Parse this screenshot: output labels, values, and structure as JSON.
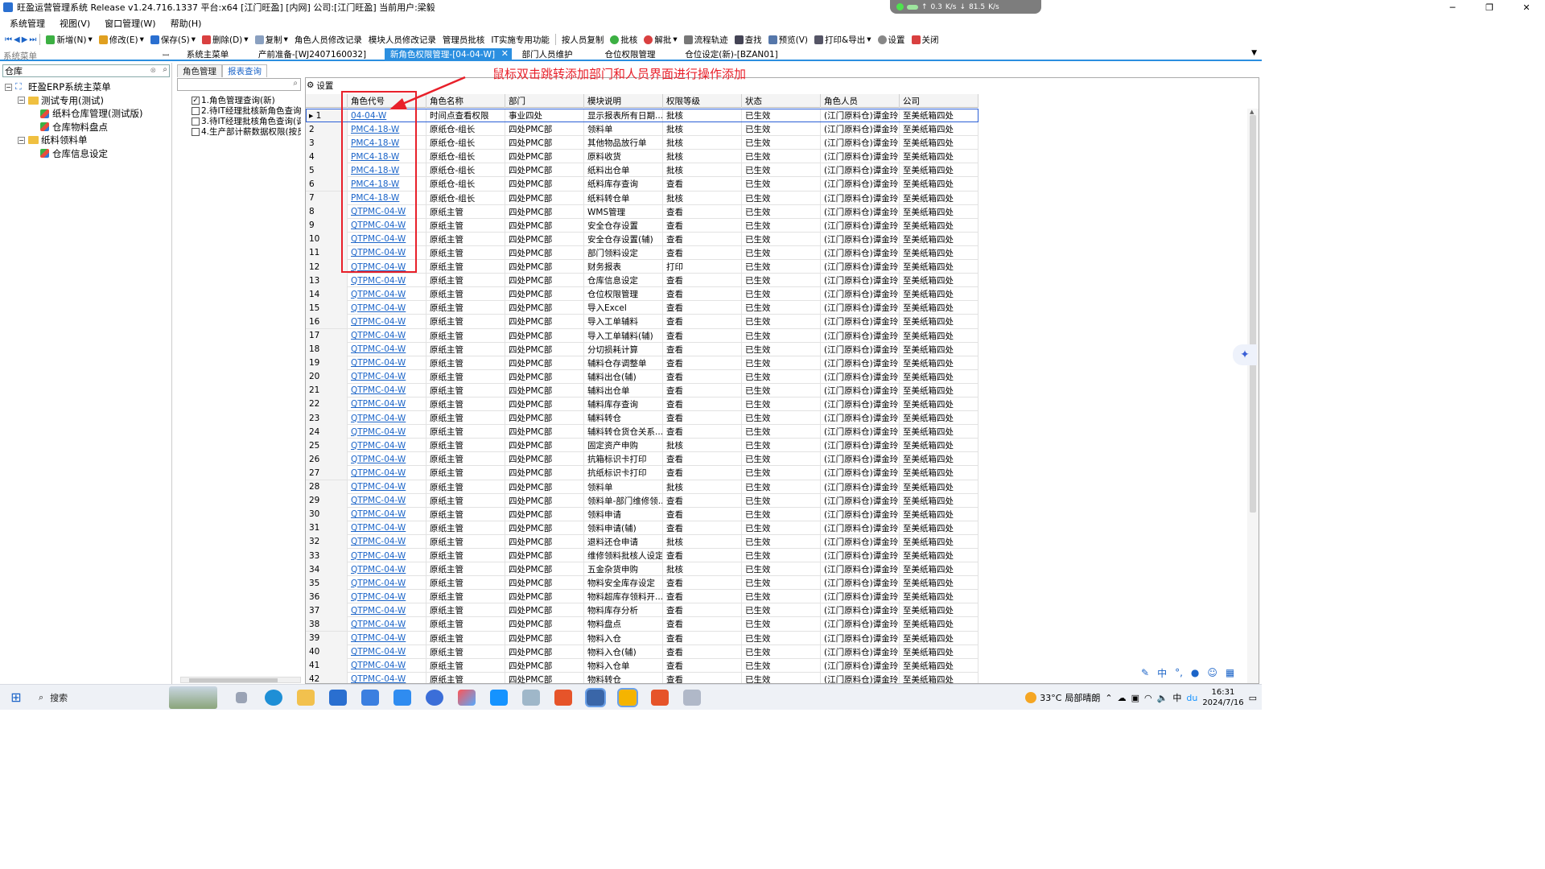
{
  "window": {
    "title": "旺盈运营管理系统 Release v1.24.716.1337 平台:x64  [江门旺盈] [内网] 公司:[江门旺盈] 当前用户:梁毅",
    "net_up": "0.3",
    "net_up_unit": "K/s",
    "net_down": "81.5",
    "net_down_unit": "K/s",
    "btn_min": "─",
    "btn_max": "❐",
    "btn_close": "✕"
  },
  "menu": [
    "系统管理",
    "视图(V)",
    "窗口管理(W)",
    "帮助(H)"
  ],
  "toolbar": {
    "new": "新增(N)",
    "edit": "修改(E)",
    "save": "保存(S)",
    "delete": "删除(D)",
    "copy": "复制",
    "role_person_log": "角色人员修改记录",
    "module_person_log": "模块人员修改记录",
    "admin_approve": "管理员批核",
    "it_func": "IT实施专用功能",
    "person_copy": "按人员复制",
    "approve": "批核",
    "unapprove": "解批",
    "flow": "流程轨迹",
    "find": "查找",
    "preview": "预览(V)",
    "print_export": "打印&导出",
    "settings": "设置",
    "close": "关闭"
  },
  "sidebar": {
    "label": "系统菜单",
    "pin": "ꟷ",
    "search_value": "仓库",
    "tree": [
      {
        "label": "旺盈ERP系统主菜单",
        "level": 0,
        "kind": "root",
        "toggle": "⊟"
      },
      {
        "label": "测试专用(测试)",
        "level": 1,
        "kind": "folder",
        "toggle": "⊟"
      },
      {
        "label": "纸料仓库管理(测试版)",
        "level": 2,
        "kind": "leaf",
        "toggle": ""
      },
      {
        "label": "仓库物料盘点",
        "level": 2,
        "kind": "leaf",
        "toggle": ""
      },
      {
        "label": "纸料领料单",
        "level": 1,
        "kind": "folder",
        "toggle": "⊟"
      },
      {
        "label": "仓库信息设定",
        "level": 2,
        "kind": "leaf",
        "toggle": ""
      }
    ]
  },
  "tabs": [
    {
      "label": "系统主菜单",
      "active": false
    },
    {
      "label": "产前准备-[WJ2407160032]",
      "active": false
    },
    {
      "label": "新角色权限管理-[04-04-W]",
      "active": true
    },
    {
      "label": "部门人员维护",
      "active": false
    },
    {
      "label": "仓位权限管理",
      "active": false
    },
    {
      "label": "仓位设定(新)-[BZAN01]",
      "active": false
    }
  ],
  "mid": {
    "subtabs": [
      "角色管理",
      "报表查询"
    ],
    "active_subtab": 1,
    "checklist": [
      {
        "label": "1.角色管理查询(新)",
        "checked": true
      },
      {
        "label": "2.待IT经理批核新角色查询",
        "checked": false
      },
      {
        "label": "3.待IT经理批核角色查询(调",
        "checked": false
      },
      {
        "label": "4.生产部计薪数据权限(按员",
        "checked": false
      }
    ]
  },
  "grid": {
    "settings_label": "设置",
    "columns": [
      "角色代号",
      "角色名称",
      "部门",
      "模块说明",
      "权限等级",
      "状态",
      "角色人员",
      "公司"
    ],
    "rows": [
      [
        "1",
        "04-04-W",
        "时间点查看权限",
        "事业四处",
        "显示报表所有日期...",
        "批核",
        "已生效",
        "(江门原料仓)谭金玲",
        "至美纸箱四处"
      ],
      [
        "2",
        "PMC4-18-W",
        "原纸仓-组长",
        "四处PMC部",
        "领料单",
        "批核",
        "已生效",
        "(江门原料仓)谭金玲",
        "至美纸箱四处"
      ],
      [
        "3",
        "PMC4-18-W",
        "原纸仓-组长",
        "四处PMC部",
        "其他物品放行单",
        "批核",
        "已生效",
        "(江门原料仓)谭金玲",
        "至美纸箱四处"
      ],
      [
        "4",
        "PMC4-18-W",
        "原纸仓-组长",
        "四处PMC部",
        "原料收货",
        "批核",
        "已生效",
        "(江门原料仓)谭金玲",
        "至美纸箱四处"
      ],
      [
        "5",
        "PMC4-18-W",
        "原纸仓-组长",
        "四处PMC部",
        "纸料出仓单",
        "批核",
        "已生效",
        "(江门原料仓)谭金玲",
        "至美纸箱四处"
      ],
      [
        "6",
        "PMC4-18-W",
        "原纸仓-组长",
        "四处PMC部",
        "纸料库存查询",
        "查看",
        "已生效",
        "(江门原料仓)谭金玲",
        "至美纸箱四处"
      ],
      [
        "7",
        "PMC4-18-W",
        "原纸仓-组长",
        "四处PMC部",
        "纸料转仓单",
        "批核",
        "已生效",
        "(江门原料仓)谭金玲",
        "至美纸箱四处"
      ],
      [
        "8",
        "QTPMC-04-W",
        "原纸主管",
        "四处PMC部",
        "WMS管理",
        "查看",
        "已生效",
        "(江门原料仓)谭金玲",
        "至美纸箱四处"
      ],
      [
        "9",
        "QTPMC-04-W",
        "原纸主管",
        "四处PMC部",
        "安全仓存设置",
        "查看",
        "已生效",
        "(江门原料仓)谭金玲",
        "至美纸箱四处"
      ],
      [
        "10",
        "QTPMC-04-W",
        "原纸主管",
        "四处PMC部",
        "安全仓存设置(辅)",
        "查看",
        "已生效",
        "(江门原料仓)谭金玲",
        "至美纸箱四处"
      ],
      [
        "11",
        "QTPMC-04-W",
        "原纸主管",
        "四处PMC部",
        "部门领料设定",
        "查看",
        "已生效",
        "(江门原料仓)谭金玲",
        "至美纸箱四处"
      ],
      [
        "12",
        "QTPMC-04-W",
        "原纸主管",
        "四处PMC部",
        "财务报表",
        "打印",
        "已生效",
        "(江门原料仓)谭金玲",
        "至美纸箱四处"
      ],
      [
        "13",
        "QTPMC-04-W",
        "原纸主管",
        "四处PMC部",
        "仓库信息设定",
        "查看",
        "已生效",
        "(江门原料仓)谭金玲",
        "至美纸箱四处"
      ],
      [
        "14",
        "QTPMC-04-W",
        "原纸主管",
        "四处PMC部",
        "仓位权限管理",
        "查看",
        "已生效",
        "(江门原料仓)谭金玲",
        "至美纸箱四处"
      ],
      [
        "15",
        "QTPMC-04-W",
        "原纸主管",
        "四处PMC部",
        "导入Excel",
        "查看",
        "已生效",
        "(江门原料仓)谭金玲",
        "至美纸箱四处"
      ],
      [
        "16",
        "QTPMC-04-W",
        "原纸主管",
        "四处PMC部",
        "导入工单辅料",
        "查看",
        "已生效",
        "(江门原料仓)谭金玲",
        "至美纸箱四处"
      ],
      [
        "17",
        "QTPMC-04-W",
        "原纸主管",
        "四处PMC部",
        "导入工单辅料(辅)",
        "查看",
        "已生效",
        "(江门原料仓)谭金玲",
        "至美纸箱四处"
      ],
      [
        "18",
        "QTPMC-04-W",
        "原纸主管",
        "四处PMC部",
        "分切损耗计算",
        "查看",
        "已生效",
        "(江门原料仓)谭金玲",
        "至美纸箱四处"
      ],
      [
        "19",
        "QTPMC-04-W",
        "原纸主管",
        "四处PMC部",
        "辅料仓存调整单",
        "查看",
        "已生效",
        "(江门原料仓)谭金玲",
        "至美纸箱四处"
      ],
      [
        "20",
        "QTPMC-04-W",
        "原纸主管",
        "四处PMC部",
        "辅料出仓(辅)",
        "查看",
        "已生效",
        "(江门原料仓)谭金玲",
        "至美纸箱四处"
      ],
      [
        "21",
        "QTPMC-04-W",
        "原纸主管",
        "四处PMC部",
        "辅料出仓单",
        "查看",
        "已生效",
        "(江门原料仓)谭金玲",
        "至美纸箱四处"
      ],
      [
        "22",
        "QTPMC-04-W",
        "原纸主管",
        "四处PMC部",
        "辅料库存查询",
        "查看",
        "已生效",
        "(江门原料仓)谭金玲",
        "至美纸箱四处"
      ],
      [
        "23",
        "QTPMC-04-W",
        "原纸主管",
        "四处PMC部",
        "辅料转仓",
        "查看",
        "已生效",
        "(江门原料仓)谭金玲",
        "至美纸箱四处"
      ],
      [
        "24",
        "QTPMC-04-W",
        "原纸主管",
        "四处PMC部",
        "辅料转仓货仓关系...",
        "查看",
        "已生效",
        "(江门原料仓)谭金玲",
        "至美纸箱四处"
      ],
      [
        "25",
        "QTPMC-04-W",
        "原纸主管",
        "四处PMC部",
        "固定资产申购",
        "批核",
        "已生效",
        "(江门原料仓)谭金玲",
        "至美纸箱四处"
      ],
      [
        "26",
        "QTPMC-04-W",
        "原纸主管",
        "四处PMC部",
        "抗箱标识卡打印",
        "查看",
        "已生效",
        "(江门原料仓)谭金玲",
        "至美纸箱四处"
      ],
      [
        "27",
        "QTPMC-04-W",
        "原纸主管",
        "四处PMC部",
        "抗纸标识卡打印",
        "查看",
        "已生效",
        "(江门原料仓)谭金玲",
        "至美纸箱四处"
      ],
      [
        "28",
        "QTPMC-04-W",
        "原纸主管",
        "四处PMC部",
        "领料单",
        "批核",
        "已生效",
        "(江门原料仓)谭金玲",
        "至美纸箱四处"
      ],
      [
        "29",
        "QTPMC-04-W",
        "原纸主管",
        "四处PMC部",
        "领料单-部门维修领...",
        "查看",
        "已生效",
        "(江门原料仓)谭金玲",
        "至美纸箱四处"
      ],
      [
        "30",
        "QTPMC-04-W",
        "原纸主管",
        "四处PMC部",
        "领料申请",
        "查看",
        "已生效",
        "(江门原料仓)谭金玲",
        "至美纸箱四处"
      ],
      [
        "31",
        "QTPMC-04-W",
        "原纸主管",
        "四处PMC部",
        "领料申请(辅)",
        "查看",
        "已生效",
        "(江门原料仓)谭金玲",
        "至美纸箱四处"
      ],
      [
        "32",
        "QTPMC-04-W",
        "原纸主管",
        "四处PMC部",
        "退料还仓申请",
        "批核",
        "已生效",
        "(江门原料仓)谭金玲",
        "至美纸箱四处"
      ],
      [
        "33",
        "QTPMC-04-W",
        "原纸主管",
        "四处PMC部",
        "维修领料批核人设定",
        "查看",
        "已生效",
        "(江门原料仓)谭金玲",
        "至美纸箱四处"
      ],
      [
        "34",
        "QTPMC-04-W",
        "原纸主管",
        "四处PMC部",
        "五金杂货申购",
        "批核",
        "已生效",
        "(江门原料仓)谭金玲",
        "至美纸箱四处"
      ],
      [
        "35",
        "QTPMC-04-W",
        "原纸主管",
        "四处PMC部",
        "物料安全库存设定",
        "查看",
        "已生效",
        "(江门原料仓)谭金玲",
        "至美纸箱四处"
      ],
      [
        "36",
        "QTPMC-04-W",
        "原纸主管",
        "四处PMC部",
        "物料超库存领料开...",
        "查看",
        "已生效",
        "(江门原料仓)谭金玲",
        "至美纸箱四处"
      ],
      [
        "37",
        "QTPMC-04-W",
        "原纸主管",
        "四处PMC部",
        "物料库存分析",
        "查看",
        "已生效",
        "(江门原料仓)谭金玲",
        "至美纸箱四处"
      ],
      [
        "38",
        "QTPMC-04-W",
        "原纸主管",
        "四处PMC部",
        "物料盘点",
        "查看",
        "已生效",
        "(江门原料仓)谭金玲",
        "至美纸箱四处"
      ],
      [
        "39",
        "QTPMC-04-W",
        "原纸主管",
        "四处PMC部",
        "物料入仓",
        "查看",
        "已生效",
        "(江门原料仓)谭金玲",
        "至美纸箱四处"
      ],
      [
        "40",
        "QTPMC-04-W",
        "原纸主管",
        "四处PMC部",
        "物料入仓(辅)",
        "查看",
        "已生效",
        "(江门原料仓)谭金玲",
        "至美纸箱四处"
      ],
      [
        "41",
        "QTPMC-04-W",
        "原纸主管",
        "四处PMC部",
        "物料入仓单",
        "查看",
        "已生效",
        "(江门原料仓)谭金玲",
        "至美纸箱四处"
      ],
      [
        "42",
        "QTPMC-04-W",
        "原纸主管",
        "四处PMC部",
        "物料转仓",
        "查看",
        "已生效",
        "(江门原料仓)谭金玲",
        "至美纸箱四处"
      ]
    ]
  },
  "annotation": {
    "text": "鼠标双击跳转添加部门和人员界面进行操作添加",
    "color": "#e8202a"
  },
  "taskbar": {
    "search": "搜索",
    "temp": "33°C",
    "weather": "局部晴朗",
    "time": "16:31",
    "date": "2024/7/16",
    "ime": "中"
  },
  "colors": {
    "accent": "#2b8fe0",
    "link": "#1b64c8",
    "highlight": "#e8202a"
  }
}
